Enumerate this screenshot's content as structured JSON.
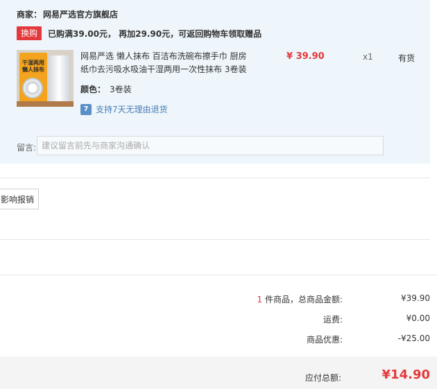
{
  "seller": {
    "prefix": "商家：",
    "name": "网易严选官方旗舰店"
  },
  "promo": {
    "badge": "换购",
    "text": "已购满39.00元， 再加29.90元，可返回购物车领取赠品"
  },
  "product": {
    "title": "网易严选 懒人抹布 百洁布洗碗布擦手巾 厨房纸巾去污吸水吸油干湿两用一次性抹布 3卷装",
    "image_text": [
      "干湿两用",
      "懒人抹布"
    ],
    "price": "¥ 39.90",
    "quantity": "x1",
    "stock": "有货",
    "variant_label": "颜色：",
    "variant_value": "3卷装",
    "return_icon": "7",
    "return_text": "支持7天无理由退货"
  },
  "note": {
    "label": "留言:",
    "placeholder": "建议留言前先与商家沟通确认"
  },
  "invoice_button": "影响报销",
  "summary": {
    "item_count": "1",
    "items_label": " 件商品，总商品金额:",
    "items_amount": "¥39.90",
    "shipping_label": "运费:",
    "shipping_amount": "¥0.00",
    "discount_label": "商品优惠:",
    "discount_amount": "-¥25.00",
    "total_label": "应付总额:",
    "total_amount": "¥14.90"
  },
  "colors": {
    "accent": "#e4393c",
    "store_bg": "#eef6fb",
    "link": "#4a7cb8"
  }
}
